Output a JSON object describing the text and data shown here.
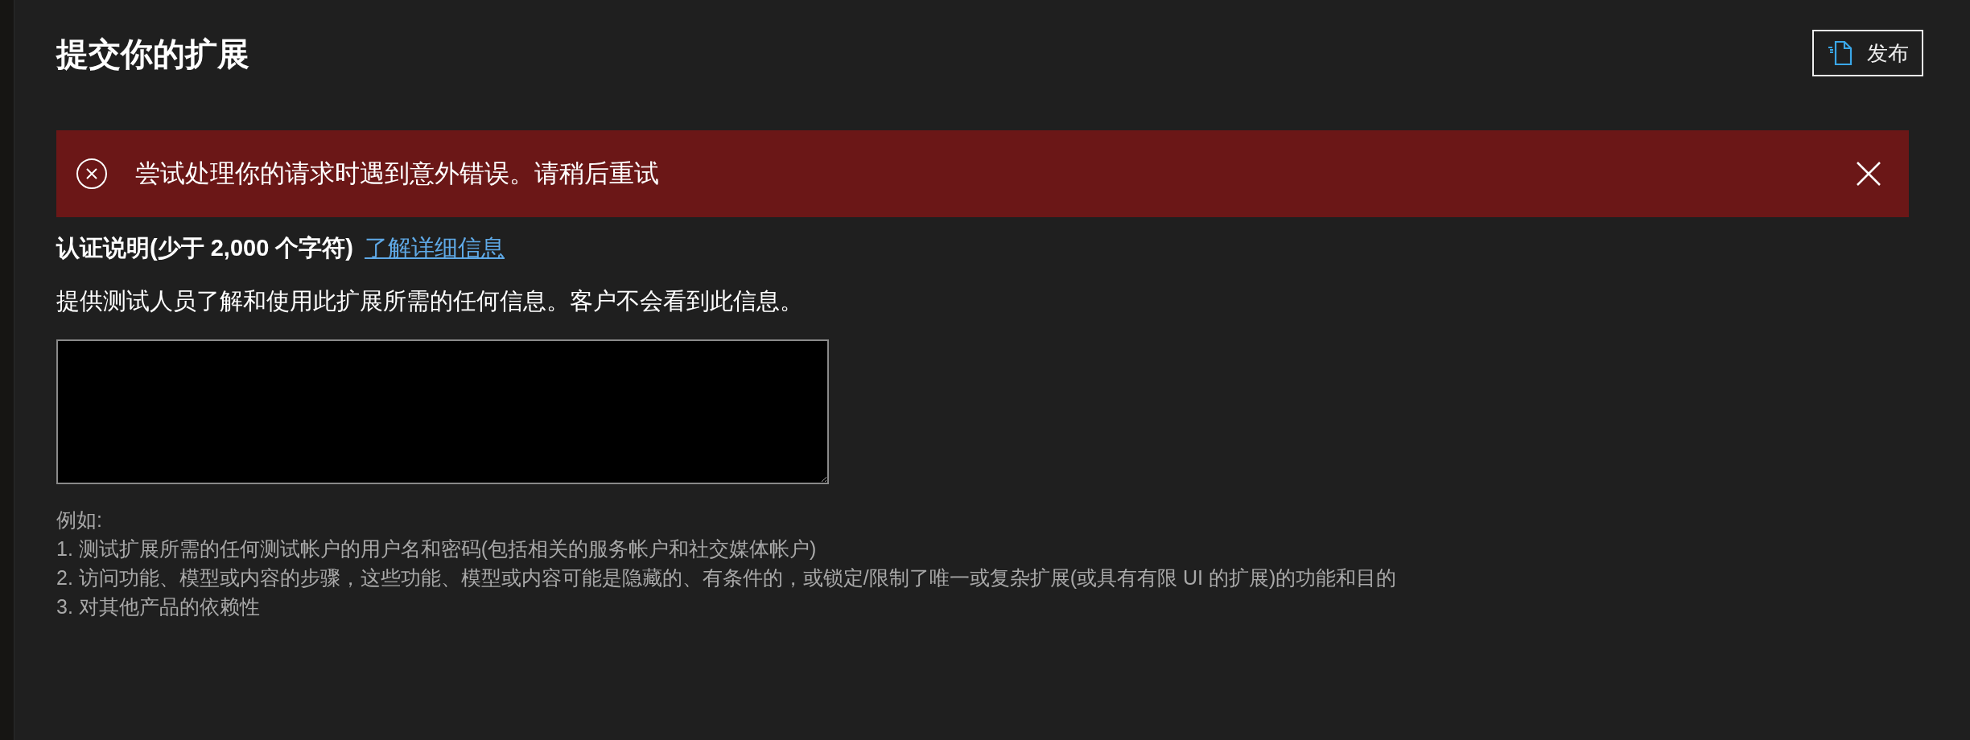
{
  "page": {
    "title": "提交你的扩展"
  },
  "publish_button": {
    "label": "发布"
  },
  "error_banner": {
    "message": "尝试处理你的请求时遇到意外错误。请稍后重试"
  },
  "notes_field": {
    "label": "认证说明(少于 2,000 个字符)",
    "link": "了解详细信息",
    "description": "提供测试人员了解和使用此扩展所需的任何信息。客户不会看到此信息。"
  },
  "examples": {
    "heading": "例如:",
    "items": [
      "1. 测试扩展所需的任何测试帐户的用户名和密码(包括相关的服务帐户和社交媒体帐户)",
      "2. 访问功能、模型或内容的步骤，这些功能、模型或内容可能是隐藏的、有条件的，或锁定/限制了唯一或复杂扩展(或具有有限 UI 的扩展)的功能和目的",
      "3. 对其他产品的依赖性"
    ]
  }
}
